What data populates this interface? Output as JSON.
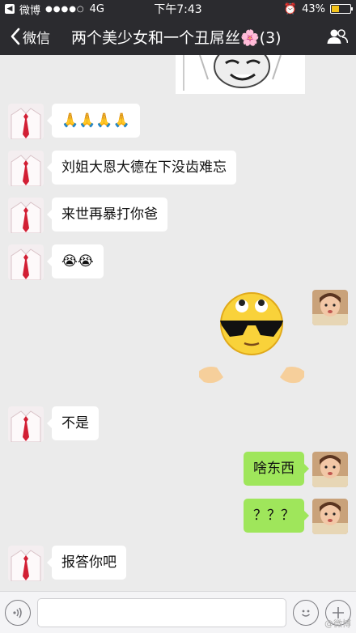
{
  "status_bar": {
    "back_app": "微博",
    "signal_dots": "●●●●○",
    "network": "4G",
    "time": "下午7:43",
    "battery_pct": "43%",
    "battery_level": 0.43
  },
  "header": {
    "back_label": "微信",
    "title": "两个美少女和一个丑屌丝🌸(3)",
    "people_icon": "group-icon"
  },
  "messages": [
    {
      "side": "left",
      "type": "text",
      "text": "🙏🙏🙏🙏"
    },
    {
      "side": "left",
      "type": "text",
      "text": "刘姐大恩大德在下没齿难忘"
    },
    {
      "side": "left",
      "type": "text",
      "text": "来世再暴打你爸"
    },
    {
      "side": "left",
      "type": "text",
      "text": "😭😭"
    },
    {
      "side": "right",
      "type": "sticker",
      "text": "😎"
    },
    {
      "side": "left",
      "type": "text",
      "text": "不是"
    },
    {
      "side": "right",
      "type": "text",
      "text": "啥东西"
    },
    {
      "side": "right",
      "type": "text",
      "text": "？？？"
    },
    {
      "side": "left",
      "type": "text",
      "text": "报答你吧"
    }
  ],
  "input_bar": {
    "voice_icon": "voice-icon",
    "emoji_icon": "emoji-icon",
    "plus_icon": "plus-icon",
    "watermark": "@微博"
  }
}
